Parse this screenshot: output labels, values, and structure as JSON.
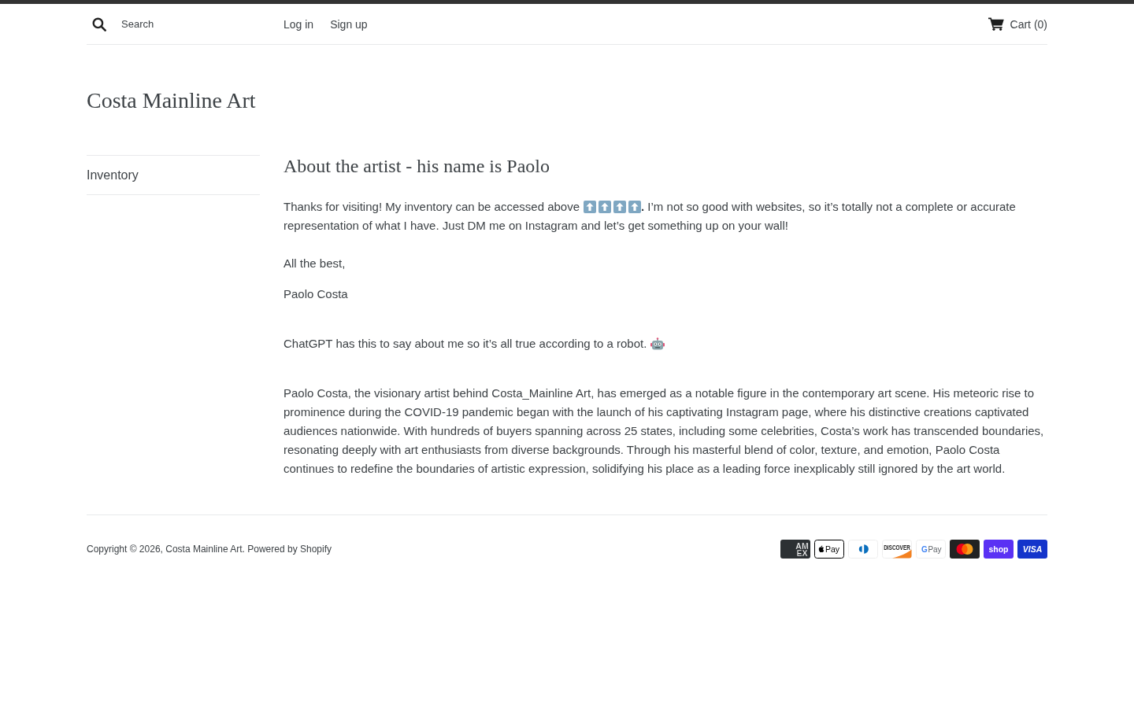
{
  "header": {
    "search": {
      "placeholder": "Search"
    },
    "links": [
      "Log in",
      "Sign up"
    ],
    "cart": "Cart (0)"
  },
  "site_title": "Costa Mainline Art",
  "sidebar": {
    "items": [
      "Inventory"
    ]
  },
  "page": {
    "title": "About the artist - his name is Paolo",
    "paragraphs": [
      {
        "segments": [
          {
            "kind": "text",
            "text": "Thanks for visiting! My inventory can be accessed above"
          },
          {
            "kind": "arrow-up-emoji"
          },
          {
            "kind": "arrow-up-emoji"
          },
          {
            "kind": "arrow-up-emoji"
          },
          {
            "kind": "arrow-up-emoji"
          },
          {
            "kind": "text",
            "text": "**.** I’m not so good with websites, so it’s totally not a complete or accurate"
          },
          {
            "kind": "text",
            "text": "representation of what I have. Just DM me on Instagram and let’s get something up on your wall!"
          }
        ]
      },
      {
        "segments": [
          {
            "kind": "text",
            "text": "All the best,"
          }
        ]
      },
      {
        "segments": [
          {
            "kind": "text",
            "text": "Paolo Costa"
          }
        ]
      },
      {
        "segments": [
          {
            "kind": "text",
            "text": "ChatGPT has this to say about me so it’s all true according to a robot."
          },
          {
            "kind": "robot-emoji"
          }
        ]
      },
      {
        "segments": [
          {
            "kind": "text",
            "text": "Paolo Costa, the visionary artist behind Costa_Mainline Art, has emerged as a notable figure in the contemporary art scene. His meteoric rise to prominence during the COVID-19 pandemic began with the launch of his captivating Instagram page, where his distinctive creations captivated audiences nationwide. With hundreds of buyers spanning across 25 states, including some celebrities, Costa’s work has transcended boundaries, resonating deeply with art enthusiasts from diverse backgrounds. Through his masterful blend of color, texture, and emotion, Paolo Costa continues to redefine the boundaries of artistic expression, solidifying his place as a leading force inexplicably still ignored by the art world."
          }
        ]
      }
    ]
  },
  "footer": {
    "copyright": "Copyright © 2026, Costa Mainline Art. Powered by Shopify",
    "payment_methods": [
      {
        "kind": "amex",
        "lines": [
          "AM",
          "EX"
        ]
      },
      {
        "kind": "apple-pay",
        "label": "Pay"
      },
      {
        "kind": "diners"
      },
      {
        "kind": "discover",
        "label": "DISCOVER"
      },
      {
        "kind": "google-pay",
        "mark": "G",
        "label": "Pay"
      },
      {
        "kind": "mastercard"
      },
      {
        "kind": "shop-pay",
        "label": "shop"
      },
      {
        "kind": "visa",
        "label": "VISA"
      }
    ]
  }
}
